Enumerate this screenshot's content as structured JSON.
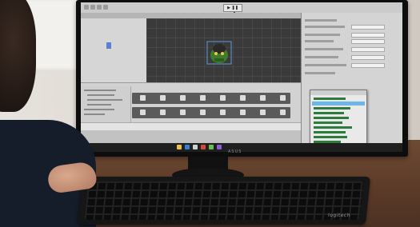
{
  "photo": {
    "monitor_brand": "ASUS",
    "keyboard_brand": "logitech"
  },
  "editor": {
    "play_label": "▶ ❚❚ ▶❚",
    "icons": [
      "hierarchy-icon",
      "scene-icon",
      "game-icon",
      "inspector-icon"
    ]
  },
  "colors": {
    "accent_green": "#2f7a3d",
    "selection_blue": "#6fb6e8"
  }
}
